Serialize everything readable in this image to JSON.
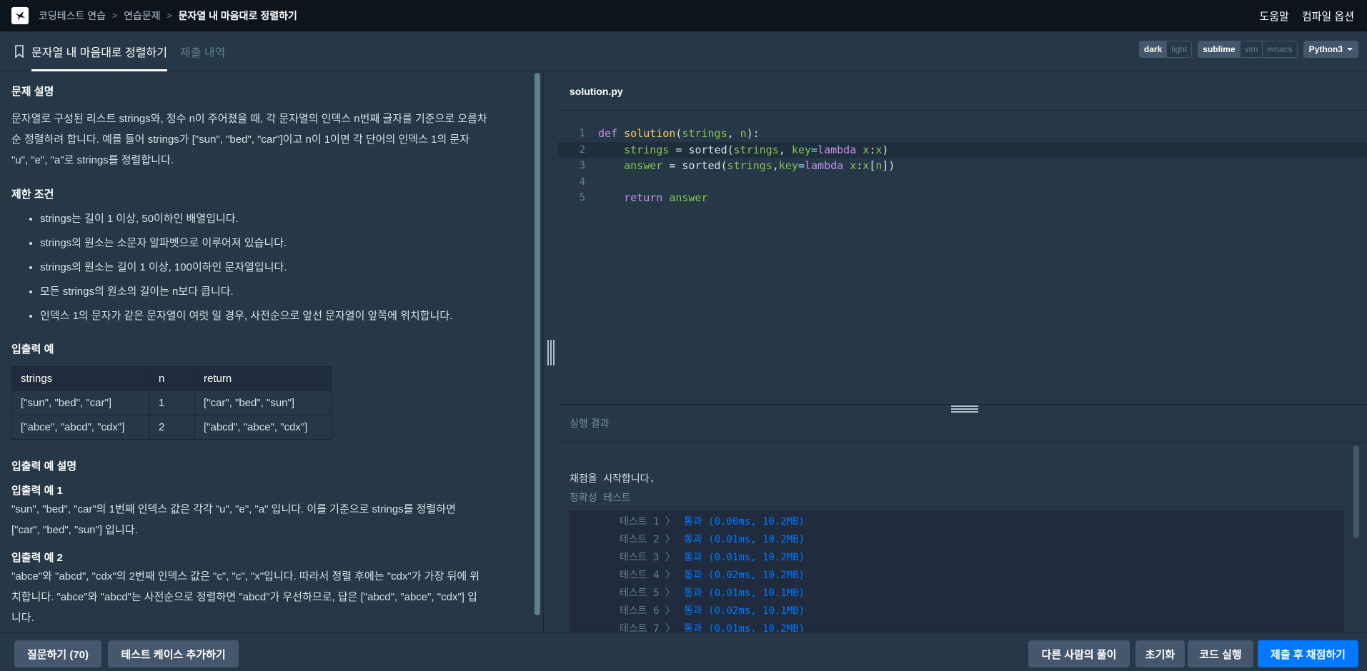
{
  "topnav": {
    "breadcrumbs": [
      "코딩테스트 연습",
      "연습문제",
      "문자열 내 마음대로 정렬하기"
    ],
    "help": "도움말",
    "compile_options": "컴파일 옵션"
  },
  "tabs": {
    "problem": "문자열 내 마음대로 정렬하기",
    "submissions": "제출 내역"
  },
  "options": {
    "theme": [
      "dark",
      "light"
    ],
    "theme_selected": "dark",
    "keymap": [
      "sublime",
      "vim",
      "emacs"
    ],
    "keymap_selected": "sublime",
    "language": "Python3"
  },
  "problem": {
    "desc_title": "문제 설명",
    "desc_lines": [
      "문자열로 구성된 리스트 strings와, 정수 n이 주어졌을 때, 각 문자열의 인덱스 n번째 글자를 기준으로 오름차",
      "순 정렬하려 합니다. 예를 들어 strings가 [\"sun\", \"bed\", \"car\"]이고 n이 1이면 각 단어의 인덱스 1의 문자",
      "\"u\", \"e\", \"a\"로 strings를 정렬합니다."
    ],
    "constraints_title": "제한 조건",
    "constraints": [
      "strings는 길이 1 이상, 50이하인 배열입니다.",
      "strings의 원소는 소문자 알파벳으로 이루어져 있습니다.",
      "strings의 원소는 길이 1 이상, 100이하인 문자열입니다.",
      "모든 strings의 원소의 길이는 n보다 큽니다.",
      "인덱스 1의 문자가 같은 문자열이 여럿 일 경우, 사전순으로 앞선 문자열이 앞쪽에 위치합니다."
    ],
    "io_title": "입출력 예",
    "io_headers": [
      "strings",
      "n",
      "return"
    ],
    "io_rows": [
      [
        "[\"sun\", \"bed\", \"car\"]",
        "1",
        "[\"car\", \"bed\", \"sun\"]"
      ],
      [
        "[\"abce\", \"abcd\", \"cdx\"]",
        "2",
        "[\"abcd\", \"abce\", \"cdx\"]"
      ]
    ],
    "io_explain_title": "입출력 예 설명",
    "ex1_title": "입출력 예 1",
    "ex1_lines": [
      "\"sun\", \"bed\", \"car\"의 1번째 인덱스 값은 각각 \"u\", \"e\", \"a\" 입니다. 이를 기준으로 strings를 정렬하면",
      "[\"car\", \"bed\", \"sun\"] 입니다."
    ],
    "ex2_title": "입출력 예 2",
    "ex2_lines": [
      "\"abce\"와 \"abcd\", \"cdx\"의 2번째 인덱스 값은 \"c\", \"c\", \"x\"입니다. 따라서 정렬 후에는 \"cdx\"가 가장 뒤에 위",
      "치합니다. \"abce\"와 \"abcd\"는 사전순으로 정렬하면 \"abcd\"가 우선하므로, 답은 [\"abcd\", \"abce\", \"cdx\"] 입",
      "니다."
    ]
  },
  "editor": {
    "filename": "solution.py",
    "line_numbers": [
      "1",
      "2",
      "3",
      "4",
      "5"
    ],
    "code": {
      "l1": {
        "kw": "def",
        "fn": "solution",
        "p1": "(",
        "a1": "strings",
        "c": ", ",
        "a2": "n",
        "p2": "):"
      },
      "l2": {
        "v1": "strings",
        "eq": " = sorted(",
        "v2": "strings",
        "c": ", ",
        "k": "key",
        "eq2": "=",
        "lam": "lambda",
        "sp": " ",
        "x1": "x",
        "col": ":",
        "x2": "x",
        "close": ")"
      },
      "l3": {
        "v1": "answer",
        "eq": " = sorted(",
        "v2": "strings",
        "c": ",",
        "k": "key",
        "eq2": "=",
        "lam": "lambda",
        "sp": " ",
        "x1": "x",
        "col": ":",
        "x2": "x",
        "ob": "[",
        "n": "n",
        "cb": "])"
      },
      "l5": {
        "kw": "return",
        "v": "answer"
      }
    }
  },
  "result": {
    "title": "실행 결과",
    "start": "채점을 시작합니다.",
    "accuracy": "정확성  테스트",
    "tests": [
      {
        "label": "테스트 1 〉",
        "value": "통과 (0.00ms, 10.2MB)"
      },
      {
        "label": "테스트 2 〉",
        "value": "통과 (0.01ms, 10.2MB)"
      },
      {
        "label": "테스트 3 〉",
        "value": "통과 (0.01ms, 10.2MB)"
      },
      {
        "label": "테스트 4 〉",
        "value": "통과 (0.02ms, 10.2MB)"
      },
      {
        "label": "테스트 5 〉",
        "value": "통과 (0.01ms, 10.1MB)"
      },
      {
        "label": "테스트 6 〉",
        "value": "통과 (0.02ms, 10.1MB)"
      },
      {
        "label": "테스트 7 〉",
        "value": "통과 (0.01ms, 10.2MB)"
      }
    ]
  },
  "bottom": {
    "ask": "질문하기 (70)",
    "add_testcase": "테스트 케이스 추가하기",
    "others": "다른 사람의 풀이",
    "reset": "초기화",
    "run": "코드 실행",
    "submit": "제출 후 채점하기"
  }
}
